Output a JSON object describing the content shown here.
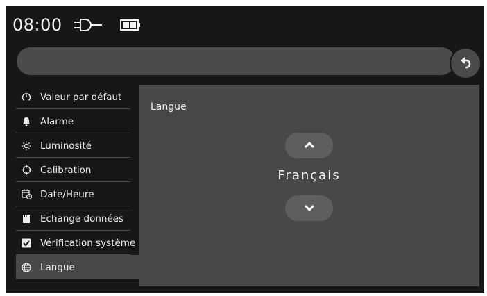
{
  "status": {
    "time": "08:00",
    "power_icon": "plug-icon",
    "battery_icon": "battery-icon"
  },
  "header": {
    "back_icon": "back-arrow-icon"
  },
  "sidebar": {
    "items": [
      {
        "label": "Valeur par défaut",
        "icon": "timer-icon"
      },
      {
        "label": "Alarme",
        "icon": "bell-icon"
      },
      {
        "label": "Luminosité",
        "icon": "brightness-icon"
      },
      {
        "label": "Calibration",
        "icon": "crosshair-icon"
      },
      {
        "label": "Date/Heure",
        "icon": "calendar-clock-icon"
      },
      {
        "label": "Echange données",
        "icon": "sd-card-icon"
      },
      {
        "label": "Vérification système",
        "icon": "checkbox-icon"
      },
      {
        "label": "Langue",
        "icon": "globe-icon"
      }
    ],
    "active_index": 7
  },
  "panel": {
    "title": "Langue",
    "value": "Français"
  },
  "colors": {
    "background": "#171717",
    "bar": "#4a4b4b",
    "panel": "#474848",
    "button": "#5d5e5e",
    "text": "#f2f2f2"
  }
}
